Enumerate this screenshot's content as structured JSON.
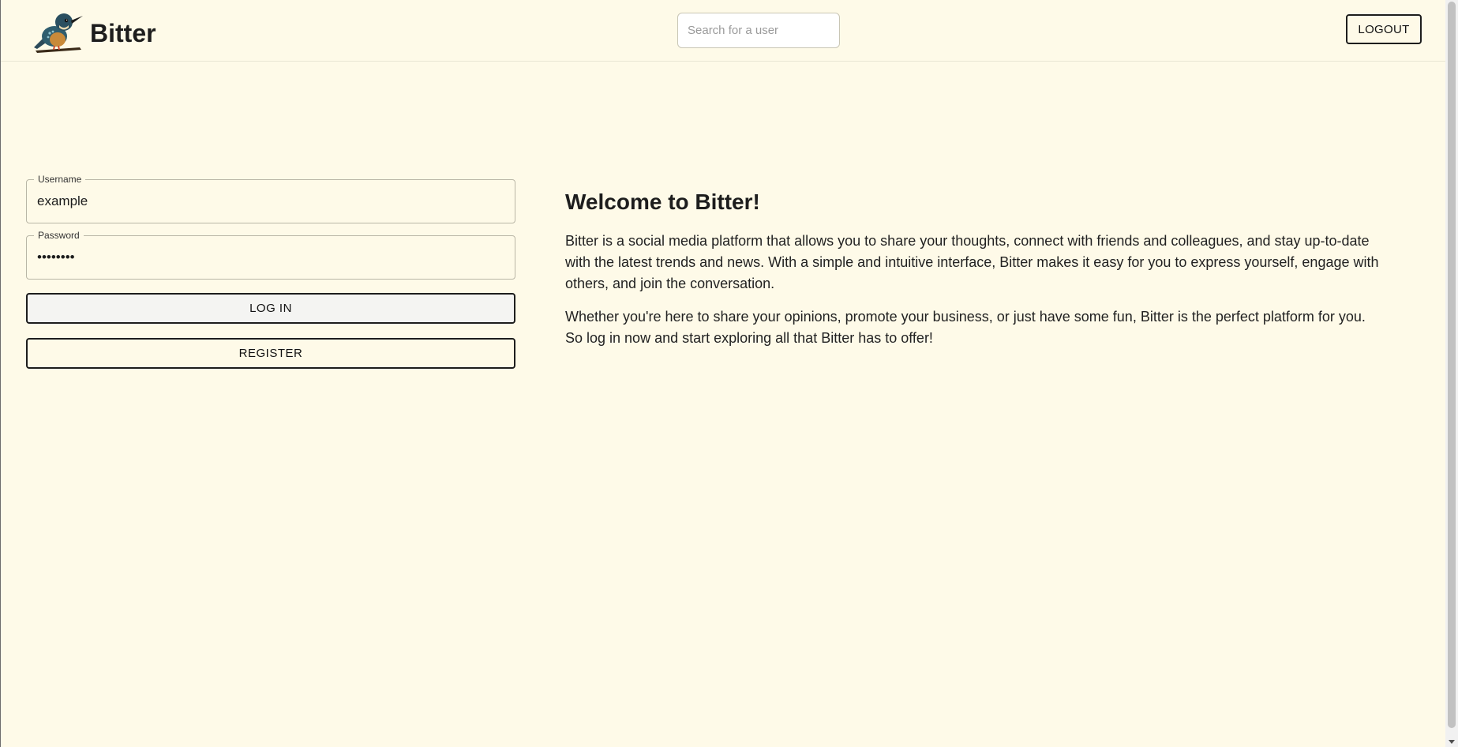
{
  "header": {
    "brand": "Bitter",
    "search_placeholder": "Search for a user",
    "logout_label": "LOGOUT"
  },
  "login": {
    "username_label": "Username",
    "username_value": "example",
    "password_label": "Password",
    "password_value": "password",
    "login_label": "LOG IN",
    "register_label": "REGISTER"
  },
  "welcome": {
    "title": "Welcome to Bitter!",
    "paragraph1": "Bitter is a social media platform that allows you to share your thoughts, connect with friends and colleagues, and stay up-to-date with the latest trends and news. With a simple and intuitive interface, Bitter makes it easy for you to express yourself, engage with others, and join the conversation.",
    "paragraph2": "Whether you're here to share your opinions, promote your business, or just have some fun, Bitter is the perfect platform for you. So log in now and start exploring all that Bitter has to offer!"
  },
  "icons": {
    "logo": "kingfisher-bird-logo"
  },
  "colors": {
    "background": "#fefae8",
    "text": "#212121",
    "border": "#1d1d1d"
  }
}
